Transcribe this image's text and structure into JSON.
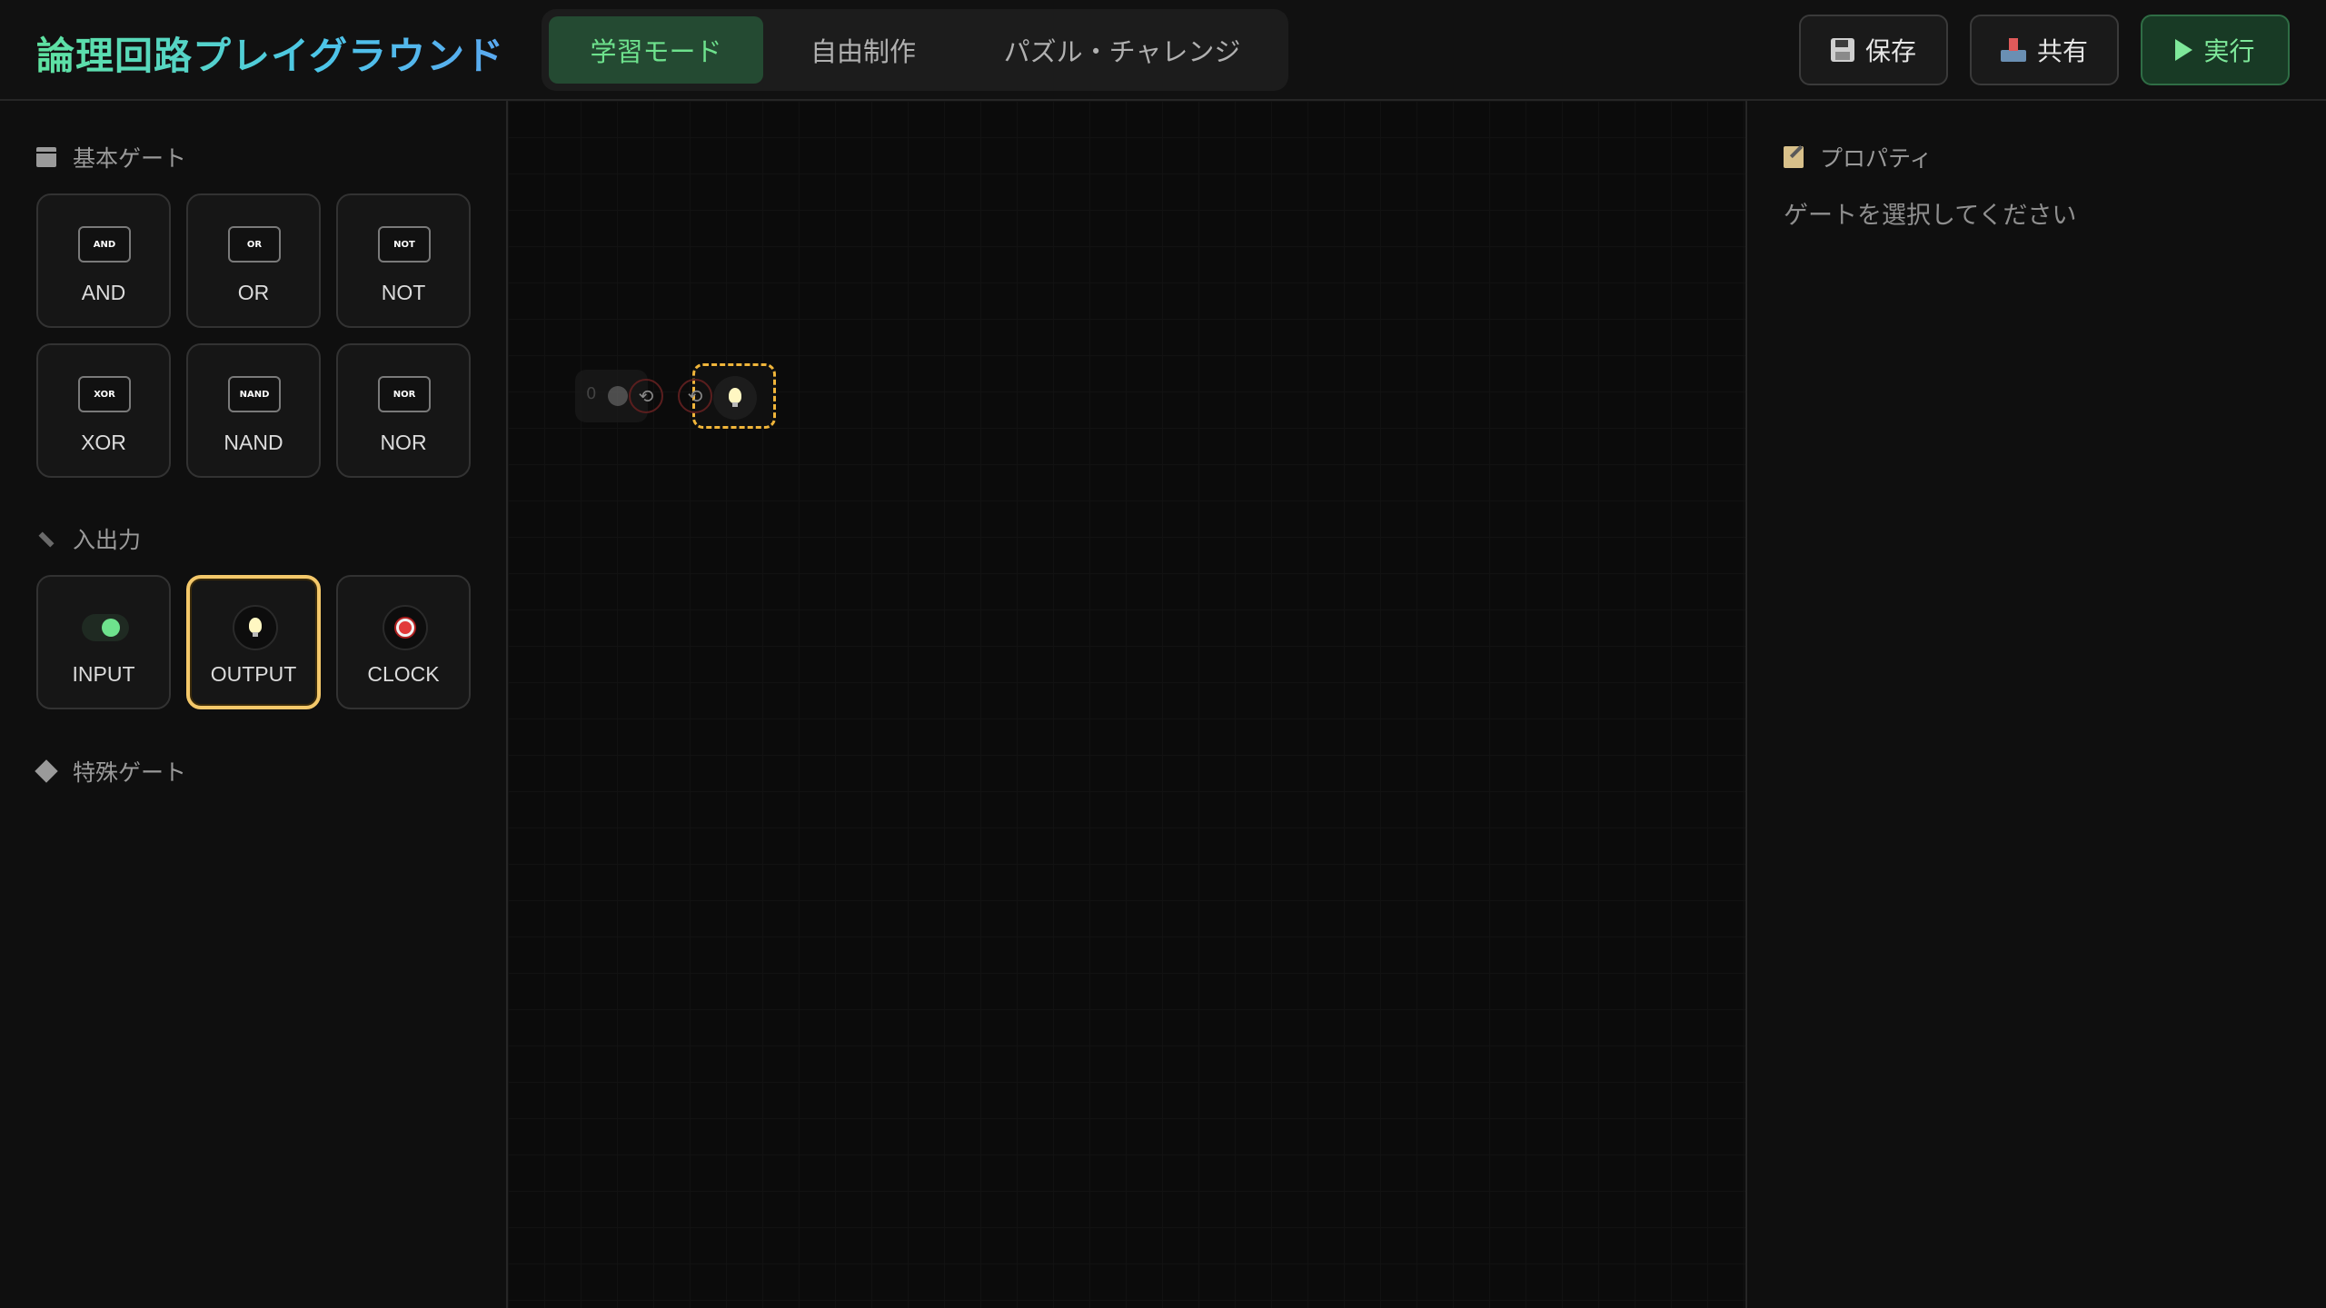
{
  "app": {
    "title": "論理回路プレイグラウンド"
  },
  "modes": [
    {
      "label": "学習モード",
      "active": true
    },
    {
      "label": "自由制作",
      "active": false
    },
    {
      "label": "パズル・チャレンジ",
      "active": false
    }
  ],
  "toolbar": {
    "save_label": "保存",
    "share_label": "共有",
    "run_label": "実行",
    "save_icon": "floppy-disk-icon",
    "share_icon": "outbox-tray-icon",
    "run_icon": "play-icon"
  },
  "sidebar": {
    "basic": {
      "title": "基本ゲート",
      "icon": "box-icon",
      "gates": [
        {
          "chip": "AND",
          "label": "AND"
        },
        {
          "chip": "OR",
          "label": "OR"
        },
        {
          "chip": "NOT",
          "label": "NOT"
        },
        {
          "chip": "XOR",
          "label": "XOR"
        },
        {
          "chip": "NAND",
          "label": "NAND"
        },
        {
          "chip": "NOR",
          "label": "NOR"
        }
      ]
    },
    "io": {
      "title": "入出力",
      "icon": "plug-icon",
      "items": [
        {
          "label": "INPUT",
          "icon": "toggle-icon"
        },
        {
          "label": "OUTPUT",
          "icon": "lightbulb-icon",
          "selected": true
        },
        {
          "label": "CLOCK",
          "icon": "alarm-clock-icon"
        }
      ]
    },
    "special": {
      "title": "特殊ゲート",
      "icon": "diamond-icon"
    }
  },
  "canvas": {
    "input_node": {
      "value": "0"
    }
  },
  "properties": {
    "title": "プロパティ",
    "empty_text": "ゲートを選択してください"
  },
  "colors": {
    "accent_green": "#6ee28d",
    "title_gradient_start": "#5fe3a0",
    "title_gradient_end": "#5aa8f0",
    "selected_border": "#f4c86a",
    "output_node_border": "#f0b53a"
  }
}
